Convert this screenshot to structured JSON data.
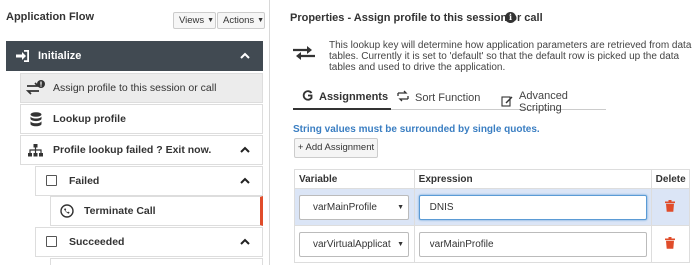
{
  "left": {
    "title": "Application Flow",
    "views_label": "Views",
    "actions_label": "Actions",
    "tree": {
      "initialize": "Initialize",
      "assign": "Assign profile to this session or call",
      "lookup": "Lookup profile",
      "failed_parent": "Profile lookup failed ? Exit now.",
      "failed": "Failed",
      "terminate": "Terminate Call",
      "succeeded": "Succeeded"
    }
  },
  "right": {
    "title": "Properties - Assign profile to this session or call",
    "description": "This lookup key will determine how application parameters are retrieved from data tables. Currently it is set to 'default' so that the default row is picked up the data tables and used to drive the application.",
    "tabs": {
      "assignments": "Assignments",
      "sort": "Sort Function",
      "advanced": "Advanced Scripting"
    },
    "hint": "String values must be surrounded by single quotes.",
    "add_button": "+ Add Assignment",
    "columns": {
      "variable": "Variable",
      "expression": "Expression",
      "delete": "Delete"
    },
    "rows": [
      {
        "variable": "varMainProfile",
        "expression": "DNIS"
      },
      {
        "variable": "varVirtualApplicat",
        "expression": "varMainProfile"
      }
    ]
  },
  "colors": {
    "initialize_bg": "#414a52",
    "terminate_accent": "#e04c2a",
    "hint_text": "#3a7ec2",
    "delete_icon": "#e04c2a",
    "selected_row": "#dbe5f6"
  }
}
